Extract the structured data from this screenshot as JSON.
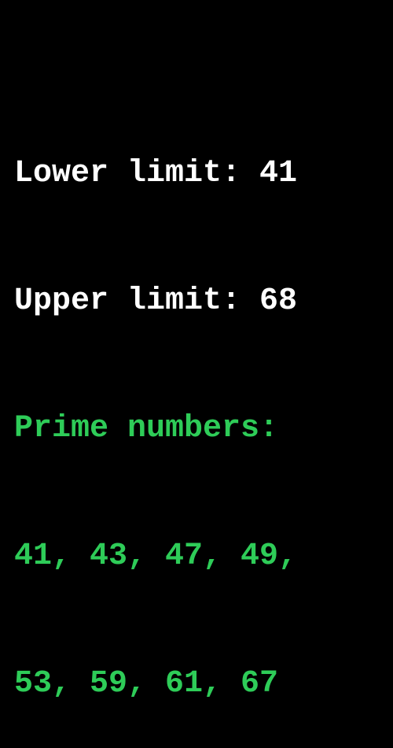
{
  "output": {
    "lower_limit_line": "Lower limit: 41",
    "upper_limit_line": "Upper limit: 68",
    "primes_header": "Prime numbers:",
    "primes_line_1": "41, 43, 47, 49,",
    "primes_line_2": "53, 59, 61, 67"
  },
  "colors": {
    "background": "#000000",
    "text_primary": "#ffffff",
    "text_accent": "#2ecc58"
  }
}
